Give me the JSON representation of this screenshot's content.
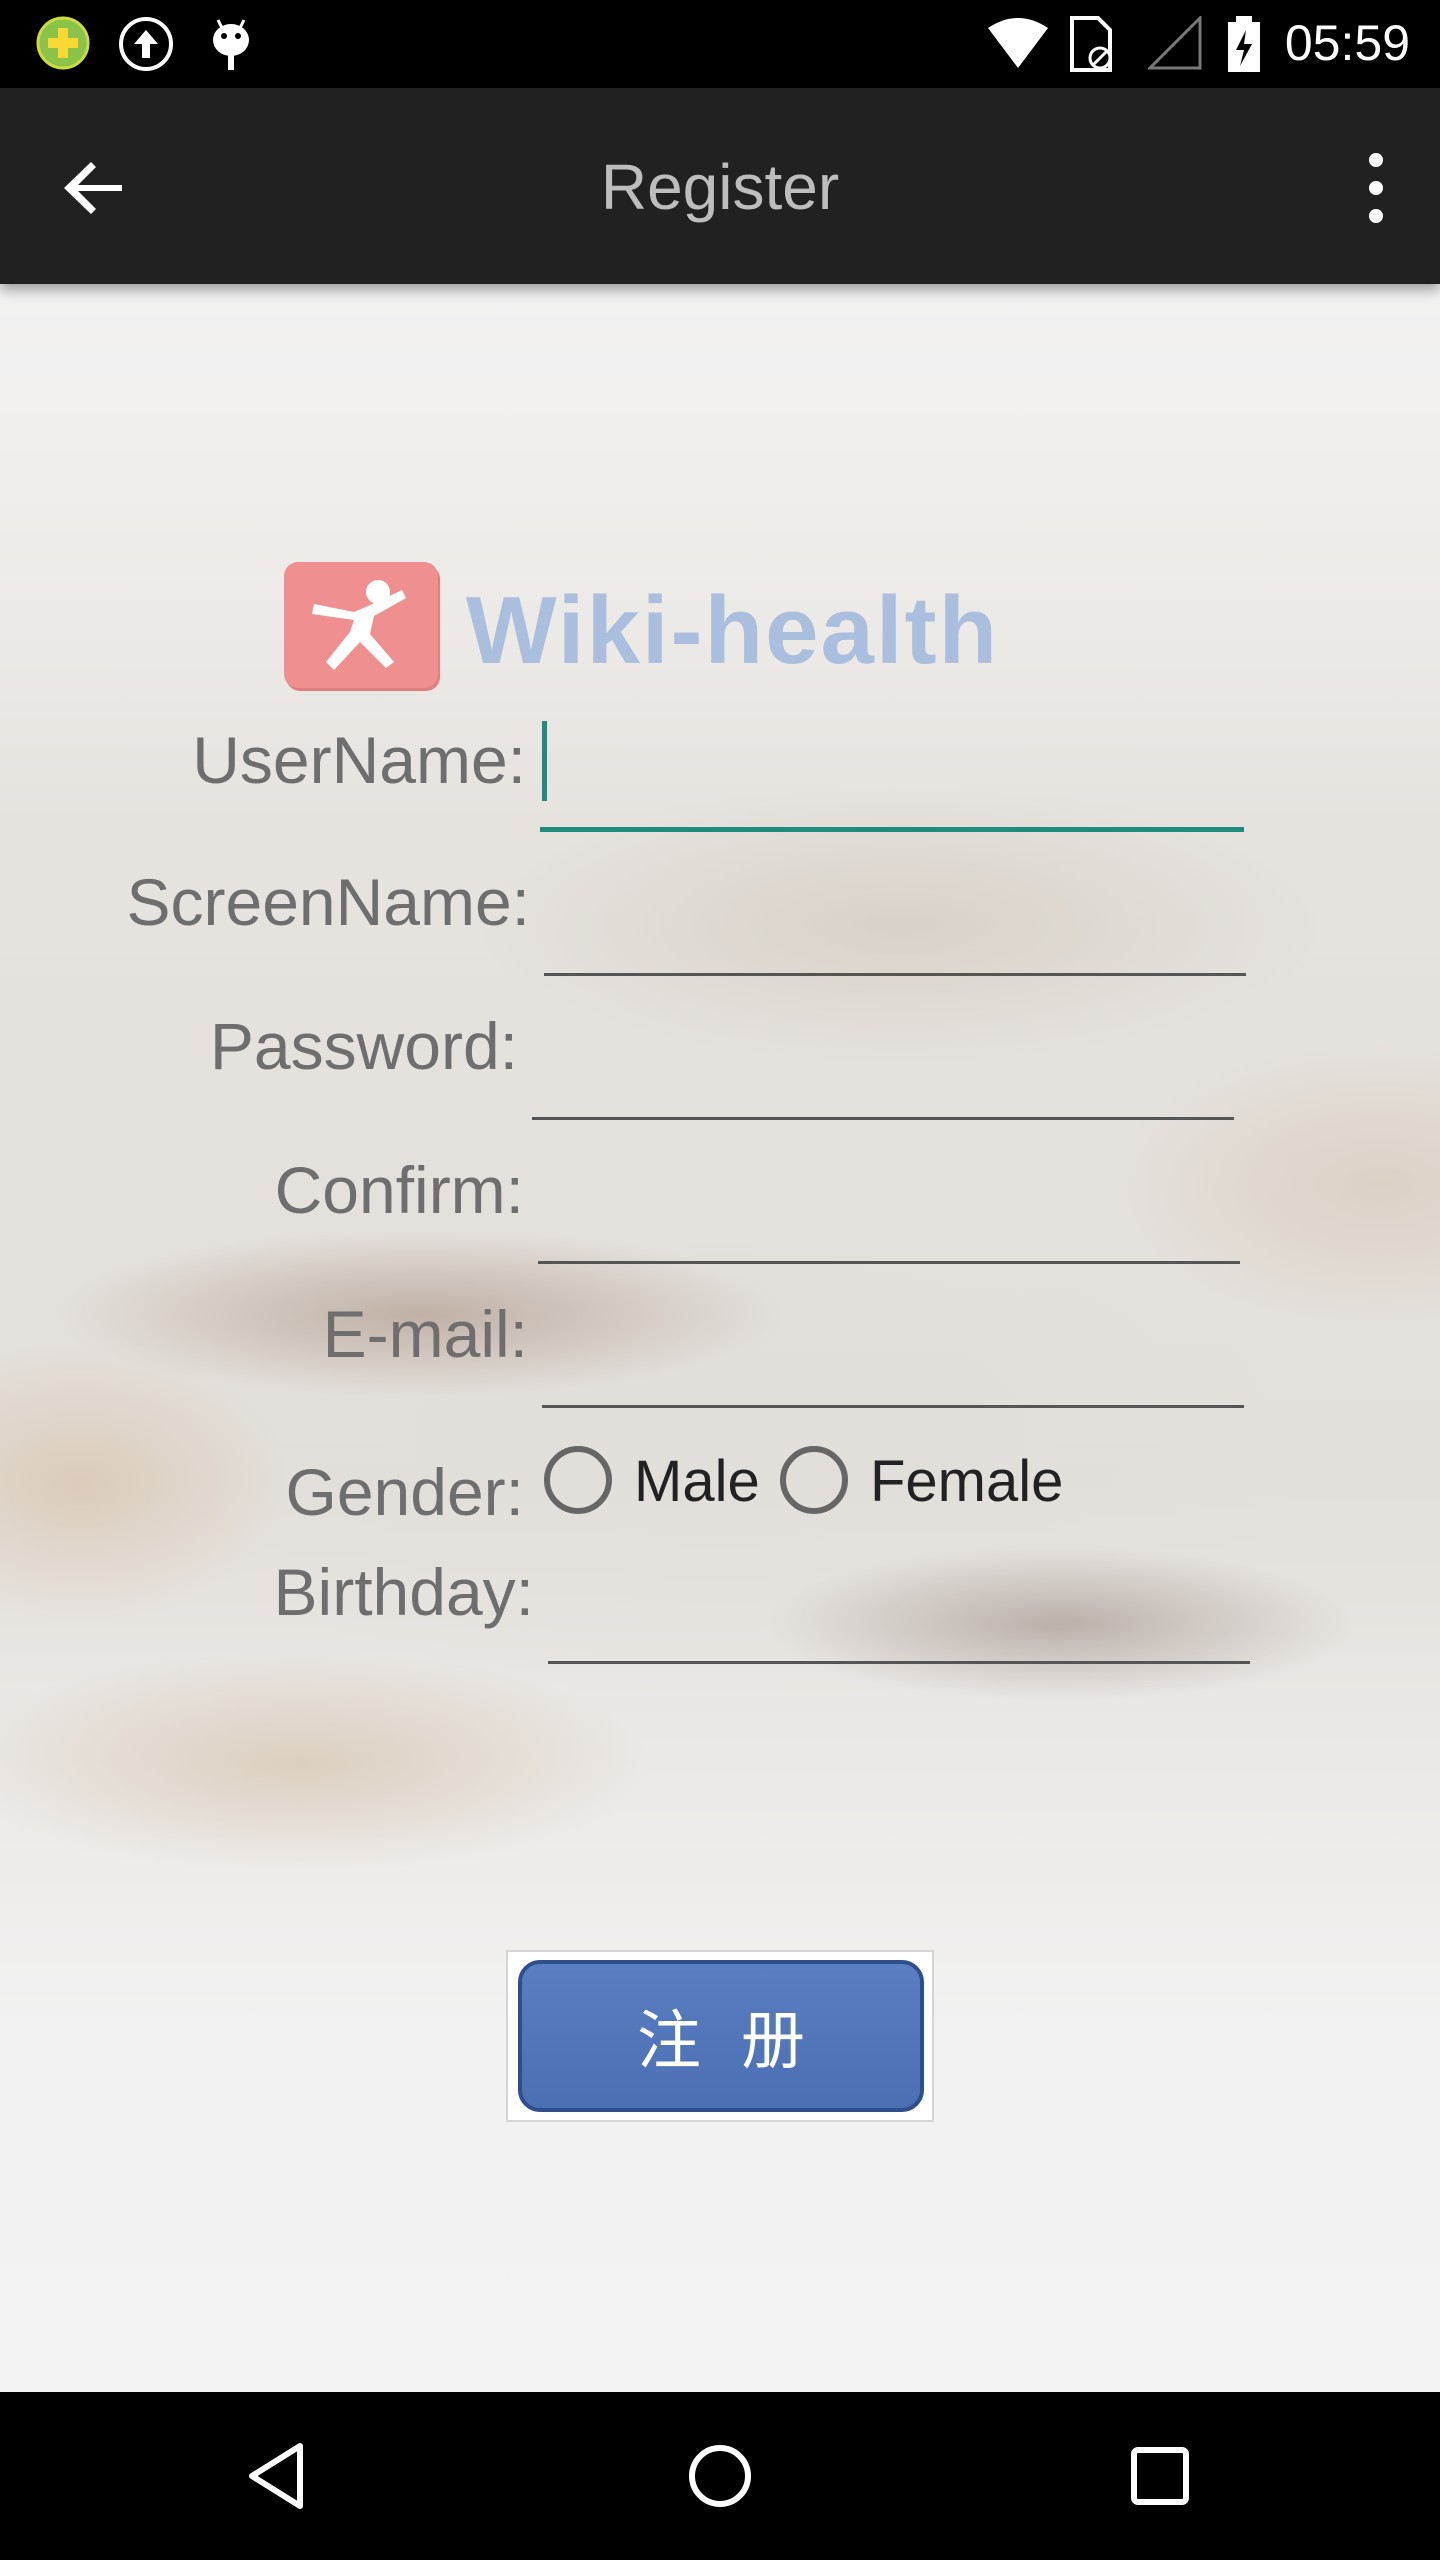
{
  "status_bar": {
    "time": "05:59",
    "icons": [
      "green-plus-icon",
      "upload-icon",
      "android-icon",
      "wifi-icon",
      "sim-icon",
      "signal-icon",
      "battery-charging-icon"
    ]
  },
  "app_bar": {
    "title": "Register",
    "back_icon": "arrow-back-icon",
    "more_icon": "more-vert-icon"
  },
  "logo": {
    "text": "Wiki-health"
  },
  "form": {
    "username": {
      "label": "UserName:",
      "value": ""
    },
    "screenname": {
      "label": "ScreenName:",
      "value": ""
    },
    "password": {
      "label": "Password:",
      "value": ""
    },
    "confirm": {
      "label": "Confirm:",
      "value": ""
    },
    "email": {
      "label": "E-mail:",
      "value": ""
    },
    "gender": {
      "label": "Gender:",
      "options": [
        "Male",
        "Female"
      ],
      "selected": null
    },
    "birthday": {
      "label": "Birthday:",
      "value": ""
    }
  },
  "register_button": {
    "label": "注册"
  },
  "colors": {
    "app_bar": "#212121",
    "accent": "#1f8b7c",
    "button": "#4f72b5",
    "logo_red": "#ef8f8f",
    "logo_blue": "#a9bfdd"
  },
  "nav_bar": {
    "icons": [
      "nav-back-icon",
      "nav-home-icon",
      "nav-recents-icon"
    ]
  }
}
